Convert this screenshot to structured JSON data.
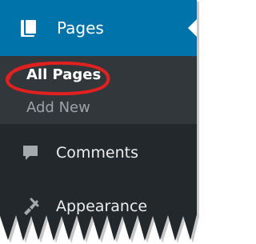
{
  "sidebar": {
    "active_menu": {
      "label": "Pages",
      "icon": "pages-icon"
    },
    "submenu": [
      {
        "label": "All Pages",
        "current": true
      },
      {
        "label": "Add New",
        "current": false
      }
    ],
    "items": [
      {
        "label": "Comments",
        "icon": "comment-icon"
      },
      {
        "label": "Appearance",
        "icon": "paintbrush-icon"
      }
    ]
  },
  "annotation": {
    "type": "circle-highlight",
    "color": "#e0211f"
  },
  "colors": {
    "menu_background": "#23282d",
    "submenu_background": "#32373c",
    "active_background": "#0073aa",
    "active_text": "#ffffff",
    "inactive_text": "#9ea3a8"
  }
}
